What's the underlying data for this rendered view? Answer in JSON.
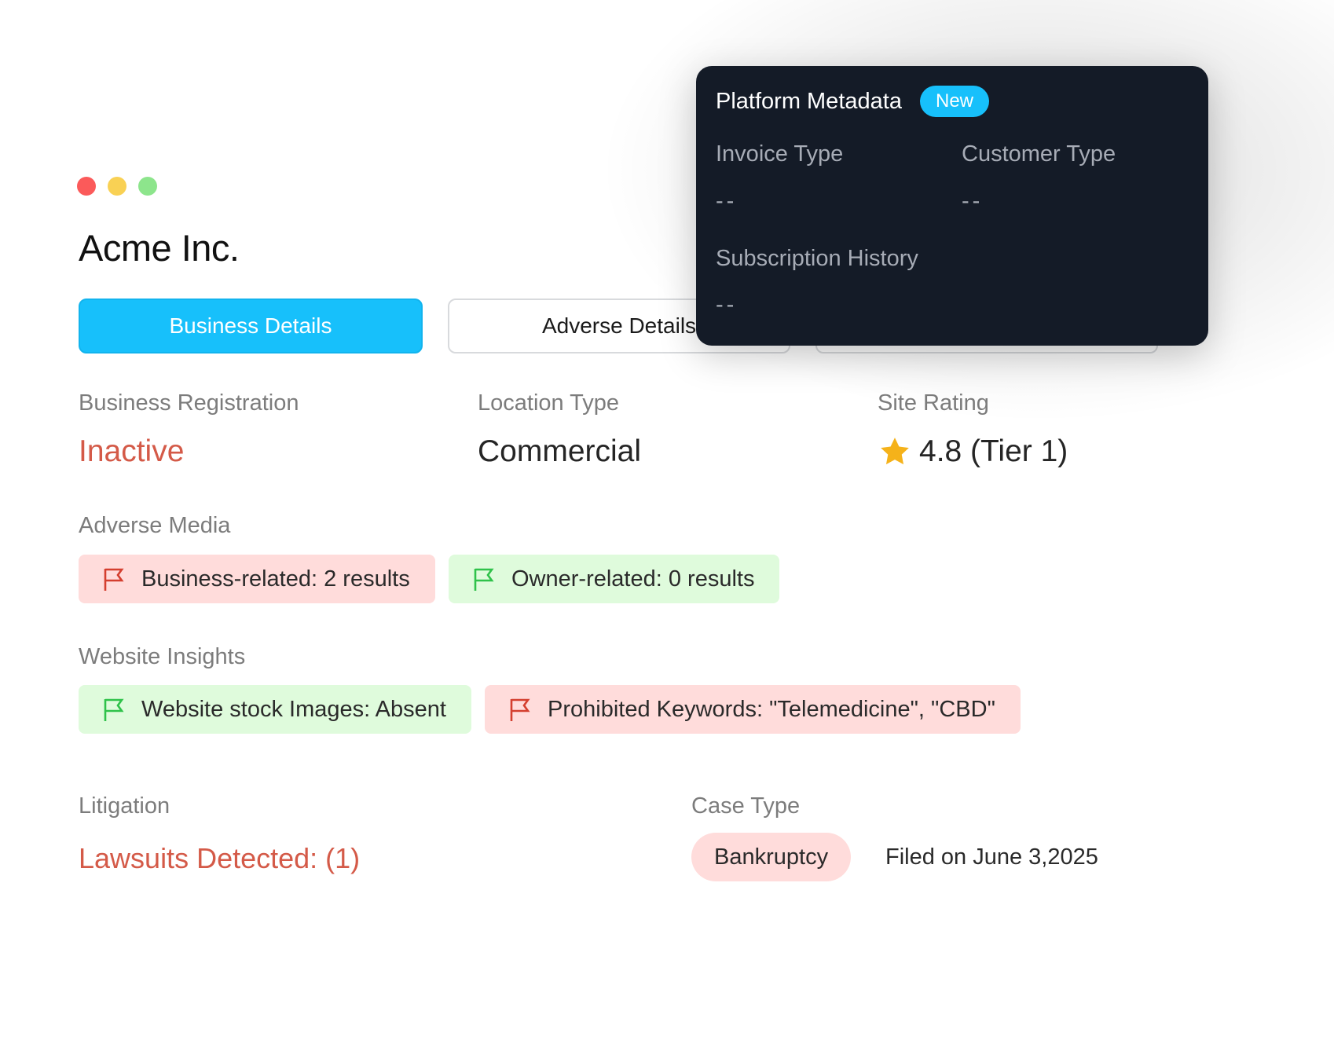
{
  "window": {
    "controls": [
      "close",
      "minimize",
      "maximize"
    ]
  },
  "company": {
    "name": "Acme Inc."
  },
  "tabs": [
    {
      "label": "Business Details",
      "active": true
    },
    {
      "label": "Adverse Details",
      "active": false
    },
    {
      "label": "",
      "active": false
    }
  ],
  "business": {
    "registration_label": "Business Registration",
    "registration_value": "Inactive",
    "location_label": "Location Type",
    "location_value": "Commercial",
    "rating_label": "Site Rating",
    "rating_value": "4.8 (Tier 1)"
  },
  "adverse_media": {
    "label": "Adverse Media",
    "chips": [
      {
        "text": "Business-related: 2 results",
        "status": "bad"
      },
      {
        "text": "Owner-related: 0 results",
        "status": "good"
      }
    ]
  },
  "website_insights": {
    "label": "Website Insights",
    "chips": [
      {
        "text": "Website stock Images: Absent",
        "status": "good"
      },
      {
        "text": "Prohibited Keywords: \"Telemedicine\", \"CBD\"",
        "status": "bad"
      }
    ]
  },
  "litigation": {
    "label": "Litigation",
    "value": "Lawsuits Detected: (1)",
    "case_type_label": "Case Type",
    "case_type_value": "Bankruptcy",
    "filed_text": "Filed on June 3,2025"
  },
  "platform_metadata": {
    "title": "Platform Metadata",
    "badge": "New",
    "fields": [
      {
        "label": "Invoice Type",
        "value": "--"
      },
      {
        "label": "Customer Type",
        "value": "--"
      },
      {
        "label": "Subscription History",
        "value": "--"
      }
    ]
  },
  "colors": {
    "accent": "#17c0fb",
    "negative_text": "#d45a48",
    "negative_bg": "#ffdcdb",
    "positive_bg": "#dffbdc",
    "positive_flag": "#2fc24a",
    "negative_flag": "#d43f2f",
    "star": "#f5b21a",
    "panel_bg": "#141b27",
    "traffic_red": "#fb5a5a",
    "traffic_yellow": "#f9d154",
    "traffic_green": "#8de58c"
  },
  "icons": {
    "flag": "flag-icon",
    "star": "star-icon"
  }
}
